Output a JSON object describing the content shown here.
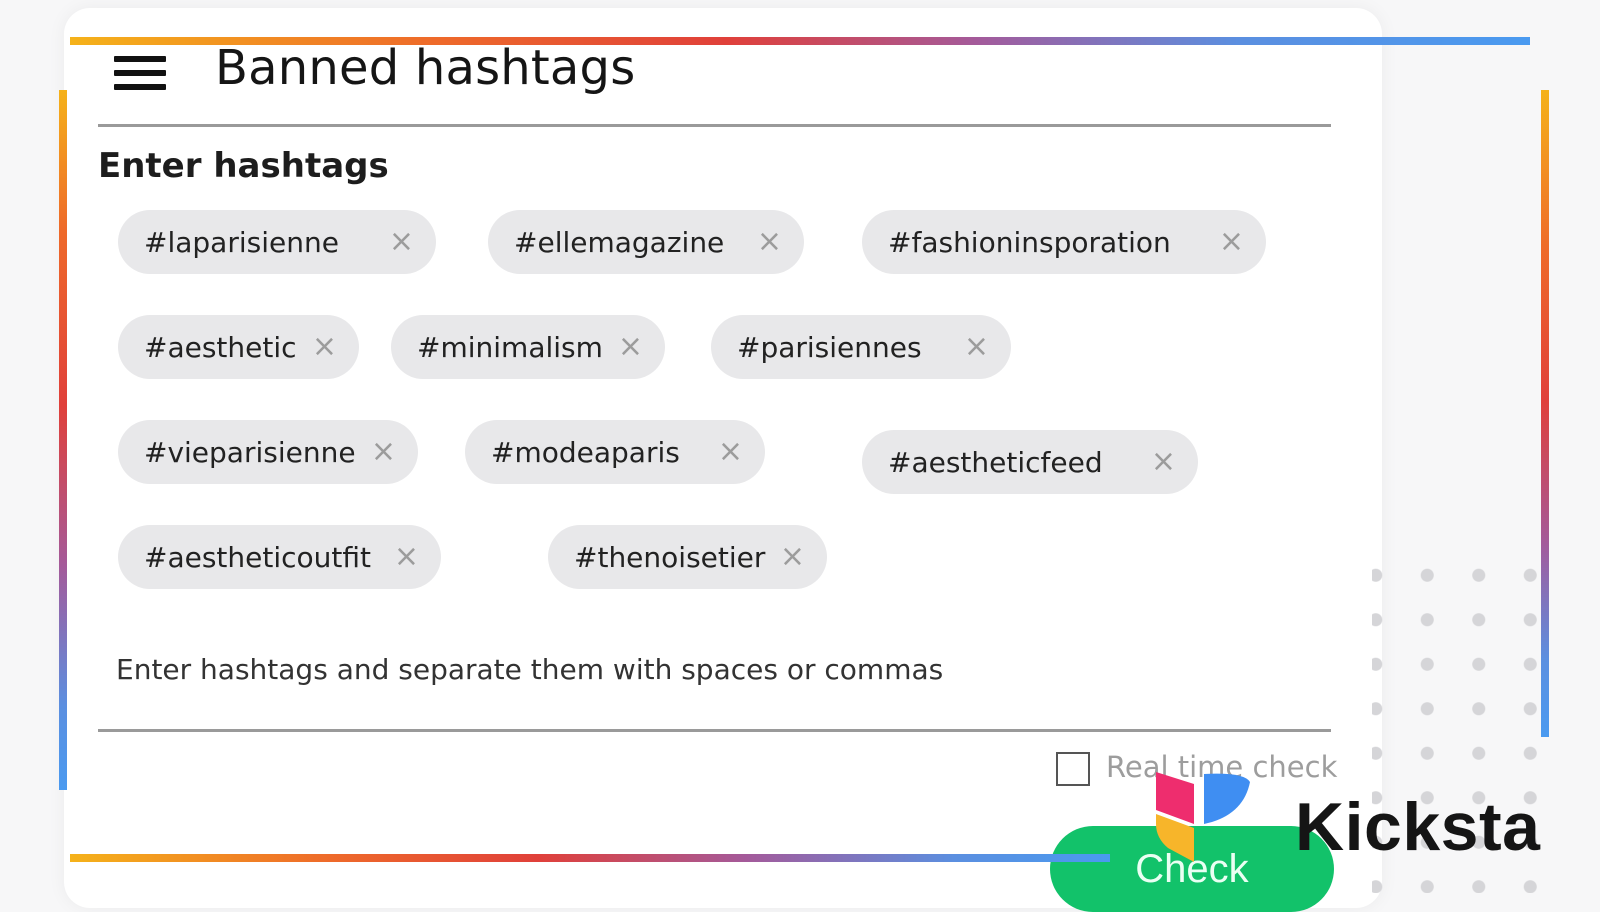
{
  "header": {
    "title": "Banned hashtags"
  },
  "form": {
    "label": "Enter hashtags",
    "hint": "Enter hashtags and separate them with spaces or commas",
    "remove_glyph": "×",
    "chips": [
      "#laparisienne",
      "#ellemagazine",
      "#fashioninsporation",
      "#aesthetic",
      "#minimalism",
      "#parisiennes",
      "#vieparisienne",
      "#modeaparis",
      "#aestheticfeed",
      "#aestheticoutfit",
      "#thenoisetier"
    ],
    "realtime_label": "Real time check",
    "realtime_checked": false,
    "check_button": "Check"
  },
  "brand": {
    "name": "Kicksta"
  },
  "colors": {
    "accent_green": "#12c26a",
    "chip_bg": "#e8e8ea",
    "gradient": [
      "#f5b21a",
      "#e0403a",
      "#a45a9a",
      "#4a9af0"
    ]
  }
}
